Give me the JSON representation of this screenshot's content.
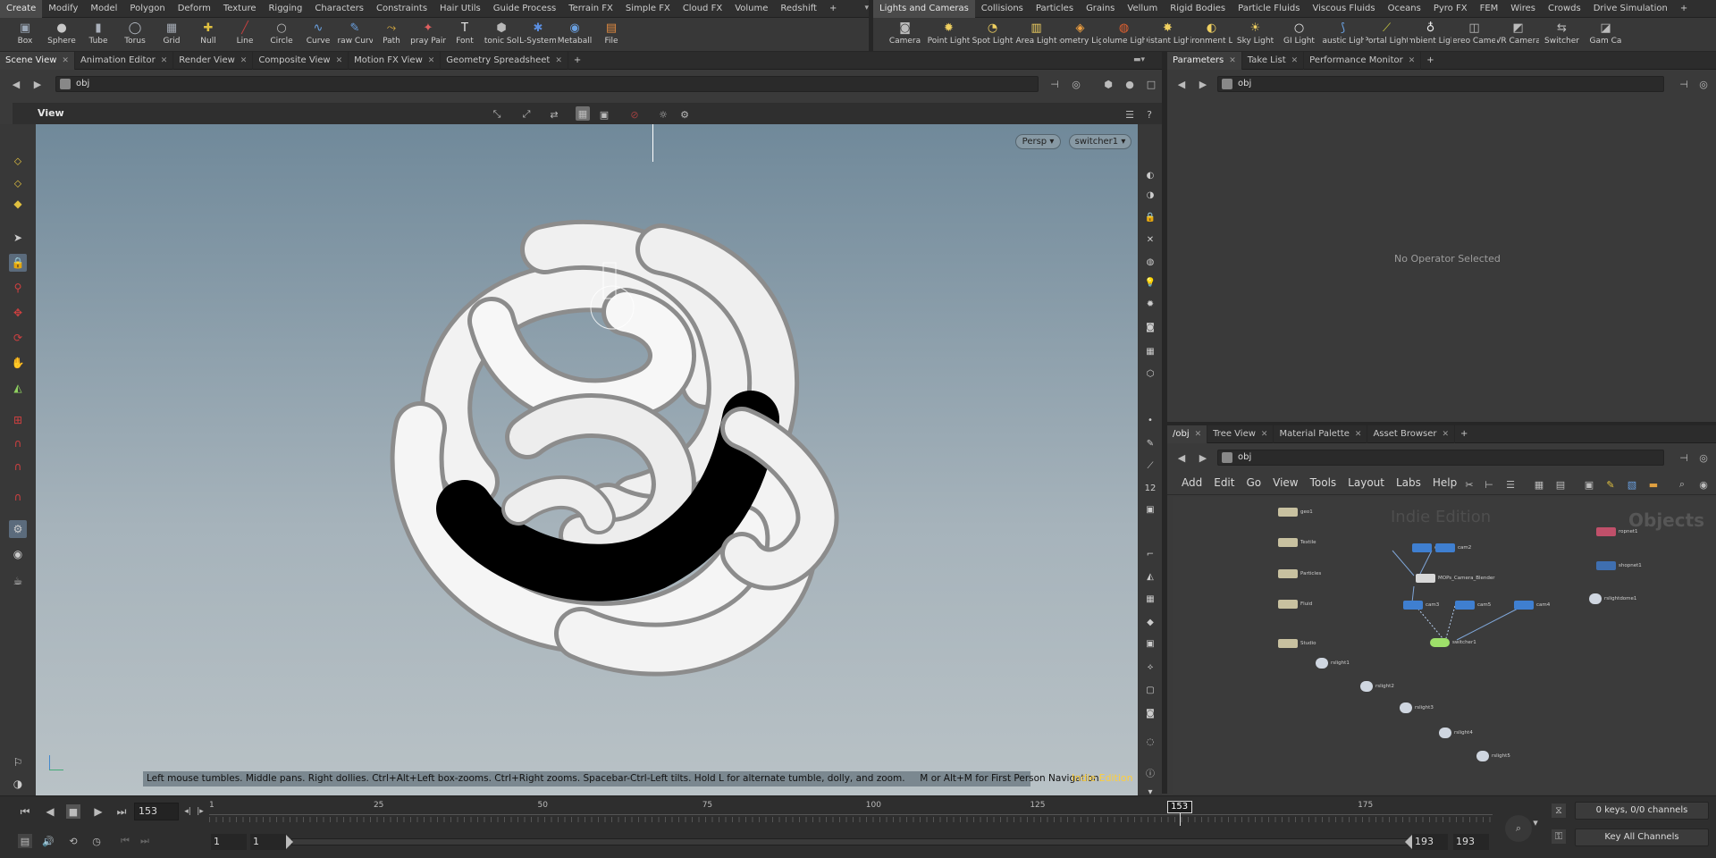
{
  "shelf_left": {
    "tabs": [
      "Create",
      "Modify",
      "Model",
      "Polygon",
      "Deform",
      "Texture",
      "Rigging",
      "Characters",
      "Constraints",
      "Hair Utils",
      "Guide Process",
      "Terrain FX",
      "Simple FX",
      "Cloud FX",
      "Volume",
      "Redshift"
    ],
    "active": 0
  },
  "shelf_right": {
    "tabs": [
      "Lights and Cameras",
      "Collisions",
      "Particles",
      "Grains",
      "Vellum",
      "Rigid Bodies",
      "Particle Fluids",
      "Viscous Fluids",
      "Oceans",
      "Pyro FX",
      "FEM",
      "Wires",
      "Crowds",
      "Drive Simulation"
    ],
    "active": 0
  },
  "tools_left": [
    {
      "label": "Box",
      "icon": "box-icon",
      "color": "#9aa6b5"
    },
    {
      "label": "Sphere",
      "icon": "sphere-icon",
      "color": "#c8c8c8"
    },
    {
      "label": "Tube",
      "icon": "tube-icon",
      "color": "#aab0bb"
    },
    {
      "label": "Torus",
      "icon": "torus-icon",
      "color": "#b9bfc9"
    },
    {
      "label": "Grid",
      "icon": "grid-icon",
      "color": "#a6acb6"
    },
    {
      "label": "Null",
      "icon": "null-icon",
      "color": "#e0c040"
    },
    {
      "label": "Line",
      "icon": "line-icon",
      "color": "#c04040"
    },
    {
      "label": "Circle",
      "icon": "circle-icon",
      "color": "#bbbbbb"
    },
    {
      "label": "Curve",
      "icon": "curve-icon",
      "color": "#6aa0e0"
    },
    {
      "label": "Draw Curve",
      "icon": "draw-curve-icon",
      "color": "#6aa0e0"
    },
    {
      "label": "Path",
      "icon": "path-icon",
      "color": "#e0b040"
    },
    {
      "label": "Spray Paint",
      "icon": "spray-paint-icon",
      "color": "#e06060"
    },
    {
      "label": "Font",
      "icon": "font-icon",
      "color": "#e6e6e6"
    },
    {
      "label": "Platonic Solids",
      "icon": "platonic-solids-icon",
      "color": "#b8b8b8"
    },
    {
      "label": "L-System",
      "icon": "l-system-icon",
      "color": "#5a8ee0"
    },
    {
      "label": "Metaball",
      "icon": "metaball-icon",
      "color": "#6aa0e0"
    },
    {
      "label": "File",
      "icon": "file-icon",
      "color": "#e08a40"
    }
  ],
  "tools_right": [
    {
      "label": "Camera",
      "icon": "camera-icon",
      "color": "#bbbbbb"
    },
    {
      "label": "Point Light",
      "icon": "point-light-icon",
      "color": "#f0d060"
    },
    {
      "label": "Spot Light",
      "icon": "spot-light-icon",
      "color": "#f0d060"
    },
    {
      "label": "Area Light",
      "icon": "area-light-icon",
      "color": "#f0d060"
    },
    {
      "label": "Geometry Light",
      "icon": "geometry-light-icon",
      "color": "#f0a040"
    },
    {
      "label": "Volume Light",
      "icon": "volume-light-icon",
      "color": "#e06030"
    },
    {
      "label": "Distant Light",
      "icon": "distant-light-icon",
      "color": "#f0d060"
    },
    {
      "label": "Environment Light",
      "icon": "environment-light-icon",
      "color": "#f0d060"
    },
    {
      "label": "Sky Light",
      "icon": "sky-light-icon",
      "color": "#f0d060"
    },
    {
      "label": "GI Light",
      "icon": "gi-light-icon",
      "color": "#e8e8e8"
    },
    {
      "label": "Caustic Light",
      "icon": "caustic-light-icon",
      "color": "#6aa0e0"
    },
    {
      "label": "Portal Light",
      "icon": "portal-light-icon",
      "color": "#d0d040"
    },
    {
      "label": "Ambient Light",
      "icon": "ambient-light-icon",
      "color": "#f0f0f0"
    },
    {
      "label": "Stereo Camera",
      "icon": "stereo-camera-icon",
      "color": "#bbbbbb"
    },
    {
      "label": "VR Camera",
      "icon": "vr-camera-icon",
      "color": "#bbbbbb"
    },
    {
      "label": "Switcher",
      "icon": "switcher-icon",
      "color": "#bbbbbb"
    },
    {
      "label": "Gam Ca",
      "icon": "gamepad-camera-icon",
      "color": "#bbbbbb"
    }
  ],
  "left_pane_tabs": [
    "Scene View",
    "Animation Editor",
    "Render View",
    "Composite View",
    "Motion FX View",
    "Geometry Spreadsheet"
  ],
  "right_top_tabs": [
    "Parameters",
    "Take List",
    "Performance Monitor"
  ],
  "right_bottom_tabs": [
    "/obj",
    "Tree View",
    "Material Palette",
    "Asset Browser"
  ],
  "path": "obj",
  "viewport": {
    "title": "View",
    "camera": "Persp",
    "camera_node": "switcher1",
    "hint": "Left mouse tumbles. Middle pans. Right dollies. Ctrl+Alt+Left box-zooms. Ctrl+Right zooms. Spacebar-Ctrl-Left tilts. Hold L for alternate tumble, dolly, and zoom.     M or Alt+M for First Person Navigation.",
    "edition": "Indie Edition"
  },
  "parameters": {
    "empty_text": "No Operator Selected"
  },
  "network": {
    "menu": [
      "Add",
      "Edit",
      "Go",
      "View",
      "Tools",
      "Layout",
      "Labs",
      "Help"
    ],
    "watermark": "Indie Edition",
    "context": "Objects",
    "nodes": [
      {
        "name": "geo1",
        "color": "#c8c1a0"
      },
      {
        "name": "Textile",
        "color": "#c8c1a0"
      },
      {
        "name": "Particles",
        "color": "#c8c1a0"
      },
      {
        "name": "Fluid",
        "color": "#c8c1a0"
      },
      {
        "name": "Studio",
        "color": "#c8c1a0"
      },
      {
        "name": "cam1",
        "color": "#3f7fd0"
      },
      {
        "name": "cam2",
        "color": "#3f7fd0"
      },
      {
        "name": "MOPs_Camera_Blender",
        "color": "#d8d8d8"
      },
      {
        "name": "cam3",
        "color": "#3f7fd0"
      },
      {
        "name": "cam5",
        "color": "#3f7fd0"
      },
      {
        "name": "cam4",
        "color": "#3f7fd0"
      },
      {
        "name": "switcher1",
        "color": "#9ee06a"
      },
      {
        "name": "rslight1",
        "color": "#cfd6e0"
      },
      {
        "name": "rslight2",
        "color": "#cfd6e0"
      },
      {
        "name": "rslight3",
        "color": "#cfd6e0"
      },
      {
        "name": "rslight4",
        "color": "#cfd6e0"
      },
      {
        "name": "rslight5",
        "color": "#cfd6e0"
      },
      {
        "name": "ropnet1",
        "color": "#c0506a"
      },
      {
        "name": "shopnet1",
        "color": "#3f6fb0"
      },
      {
        "name": "rslightdome1",
        "color": "#cfd6e0"
      }
    ]
  },
  "timeline": {
    "current_frame": "153",
    "marker": "153",
    "ticks": [
      "1",
      "25",
      "50",
      "75",
      "100",
      "125",
      "175"
    ],
    "fraction": 0.756,
    "start": "1",
    "start2": "1",
    "end": "193",
    "end2": "193",
    "keys_info": "0 keys, 0/0 channels",
    "key_all": "Key All Channels"
  }
}
